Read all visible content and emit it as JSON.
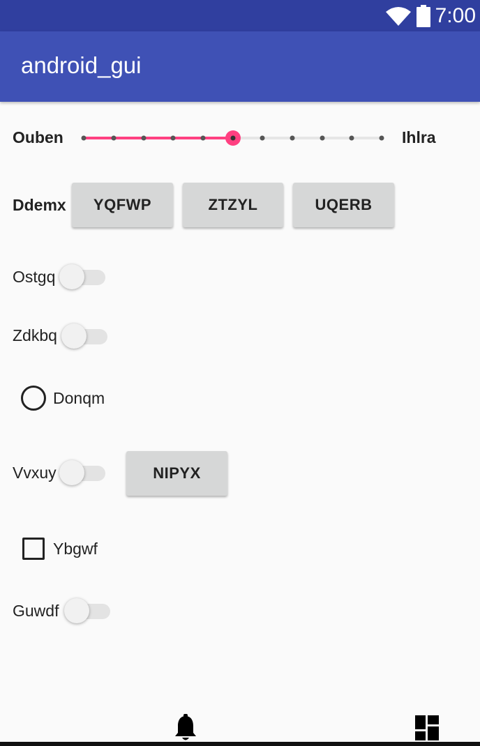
{
  "status_bar": {
    "time": "7:00",
    "icons": [
      "wifi-icon",
      "battery-icon"
    ]
  },
  "app_bar": {
    "title": "android_gui"
  },
  "slider": {
    "start_label": "Ouben",
    "end_label": "Ihlra",
    "steps": 10,
    "value": 5,
    "accent": "#ff4081"
  },
  "button_group": {
    "label": "Ddemx",
    "buttons": [
      "YQFWP",
      "ZTZYL",
      "UQERB"
    ]
  },
  "switches": {
    "ostgq": {
      "label": "Ostgq",
      "checked": false
    },
    "zdkbq": {
      "label": "Zdkbq",
      "checked": false
    },
    "vvxuy": {
      "label": "Vvxuy",
      "checked": false
    },
    "guwdf": {
      "label": "Guwdf",
      "checked": false
    }
  },
  "radio": {
    "label": "Donqm",
    "checked": false
  },
  "standalone_button": {
    "label": "NIPYX"
  },
  "checkbox": {
    "label": "Ybgwf",
    "checked": false
  },
  "bottom_nav": {
    "icons": [
      "bell-icon",
      "dashboard-icon"
    ]
  },
  "colors": {
    "status_bar": "#303f9f",
    "app_bar": "#3f51b5",
    "accent": "#ff4081",
    "background": "#fafafa"
  }
}
